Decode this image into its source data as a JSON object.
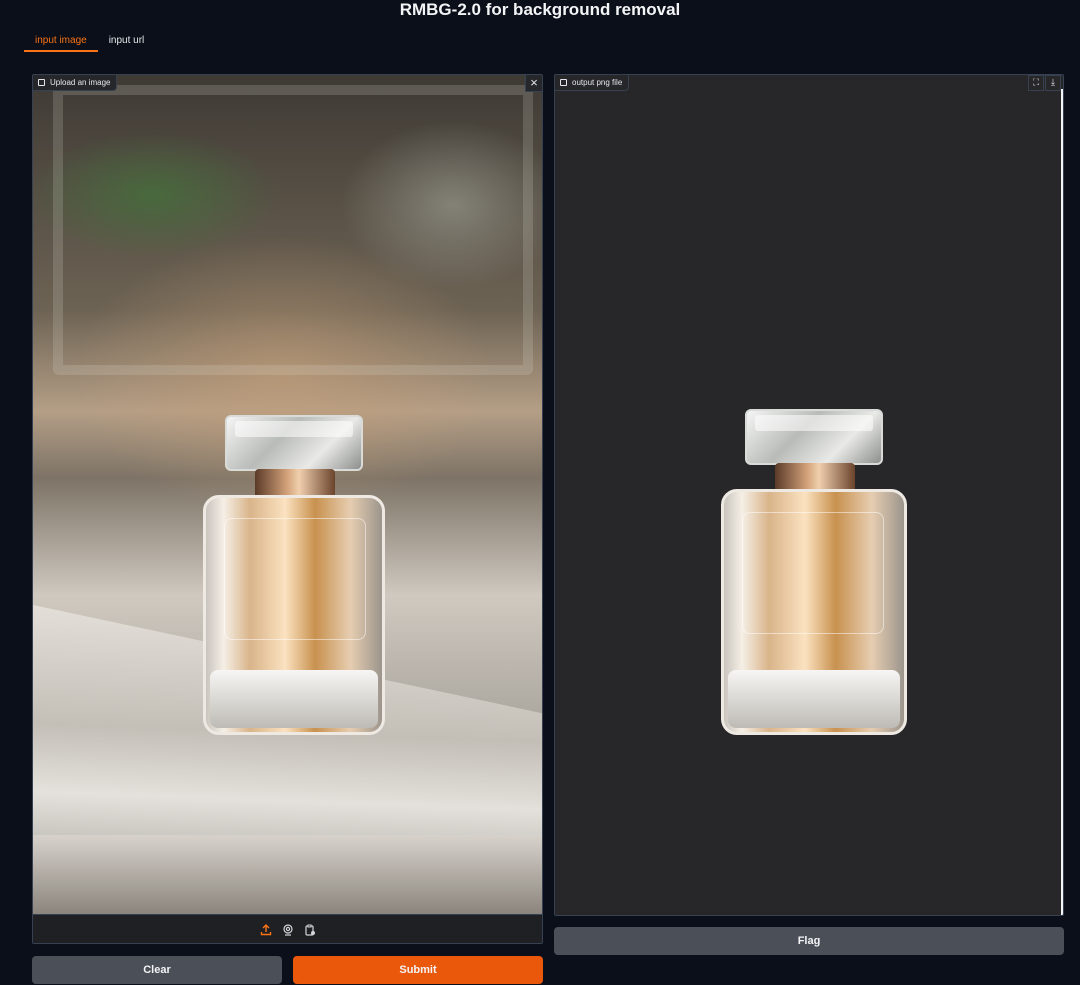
{
  "app": {
    "title": "RMBG-2.0 for background removal"
  },
  "tabs": [
    {
      "label": "input image",
      "active": true
    },
    {
      "label": "input url",
      "active": false
    }
  ],
  "input": {
    "label": "Upload an image",
    "close_icon": "close-icon",
    "source_icons": [
      "upload-icon",
      "webcam-icon",
      "clipboard-icon"
    ]
  },
  "output": {
    "label": "output png file",
    "tool_icons": [
      "fullscreen-icon",
      "download-icon"
    ]
  },
  "buttons": {
    "clear": "Clear",
    "submit": "Submit",
    "flag": "Flag"
  },
  "colors": {
    "accent": "#ea580c",
    "background": "#0b0f19",
    "secondary_button": "#4b4f57"
  }
}
